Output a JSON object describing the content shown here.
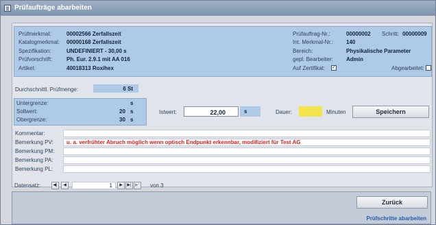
{
  "window": {
    "title": "Prüfaufträge abarbeiten"
  },
  "left": {
    "items": [
      {
        "label": "Prüfmerkmal:",
        "value": "00002566  Zerfallszeit"
      },
      {
        "label": "Katalogmerkmal:",
        "value": "00000168  Zerfallszeit"
      },
      {
        "label": "Spezifikation:",
        "value": "UNDEFINIERT - 30,00 s"
      },
      {
        "label": "Prüfvorschrift:",
        "value": "Ph. Eur. 2.9.1 mit AA 016"
      },
      {
        "label": "Artikel:",
        "value": "40018313  Roxihex"
      }
    ]
  },
  "right": {
    "items": [
      {
        "label": "Prüfauftrag-Nr.:",
        "value": "00000002"
      },
      {
        "label": "Int. Merkmal-Nr.:",
        "value": "140"
      },
      {
        "label": "Bereich:",
        "value": "Physikalische Parameter"
      },
      {
        "label": "gepl. Bearbeiter:",
        "value": "Admin"
      }
    ],
    "schritt_label": "Schritt:",
    "schritt_value": "00000009",
    "zertifikat_label": "Auf Zertifikat:",
    "zertifikat_checked": "✓",
    "abgearbeitet_label": "Abgearbeitet:"
  },
  "pruefmenge": {
    "label": "Durchschnittl. Prüfmenge:",
    "value": "6 St"
  },
  "limits": {
    "unter": {
      "label": "Untergrenze:",
      "value": "",
      "unit": "s"
    },
    "soll": {
      "label": "Sollwert:",
      "value": "20",
      "unit": "s"
    },
    "ober": {
      "label": "Obergrenze:",
      "value": "30",
      "unit": "s"
    }
  },
  "istwert": {
    "label": "Istwert:",
    "value": "22,00",
    "unit": "s"
  },
  "dauer": {
    "label": "Dauer:",
    "unit": "Minuten"
  },
  "buttons": {
    "speichern": "Speichern",
    "zurueck": "Zurück"
  },
  "remarks": [
    {
      "label": "Kommentar:",
      "value": ""
    },
    {
      "label": "Bemerkung PV:",
      "value": "u. a. verfrühter Abruch möglich wenn optisch Endpunkt erkennbar, modifiziert für Test AG"
    },
    {
      "label": "Bemerkung PM:",
      "value": ""
    },
    {
      "label": "Bemerkung PA:",
      "value": ""
    },
    {
      "label": "Bemerkung PL:",
      "value": ""
    }
  ],
  "nav": {
    "label": "Datensatz:",
    "current": "1",
    "of": "von 3"
  },
  "status": "Prüfschritte abarbeiten",
  "colors": {
    "panel": "#aecae6",
    "red": "#d1241f",
    "dauer": "#f2e44a"
  }
}
